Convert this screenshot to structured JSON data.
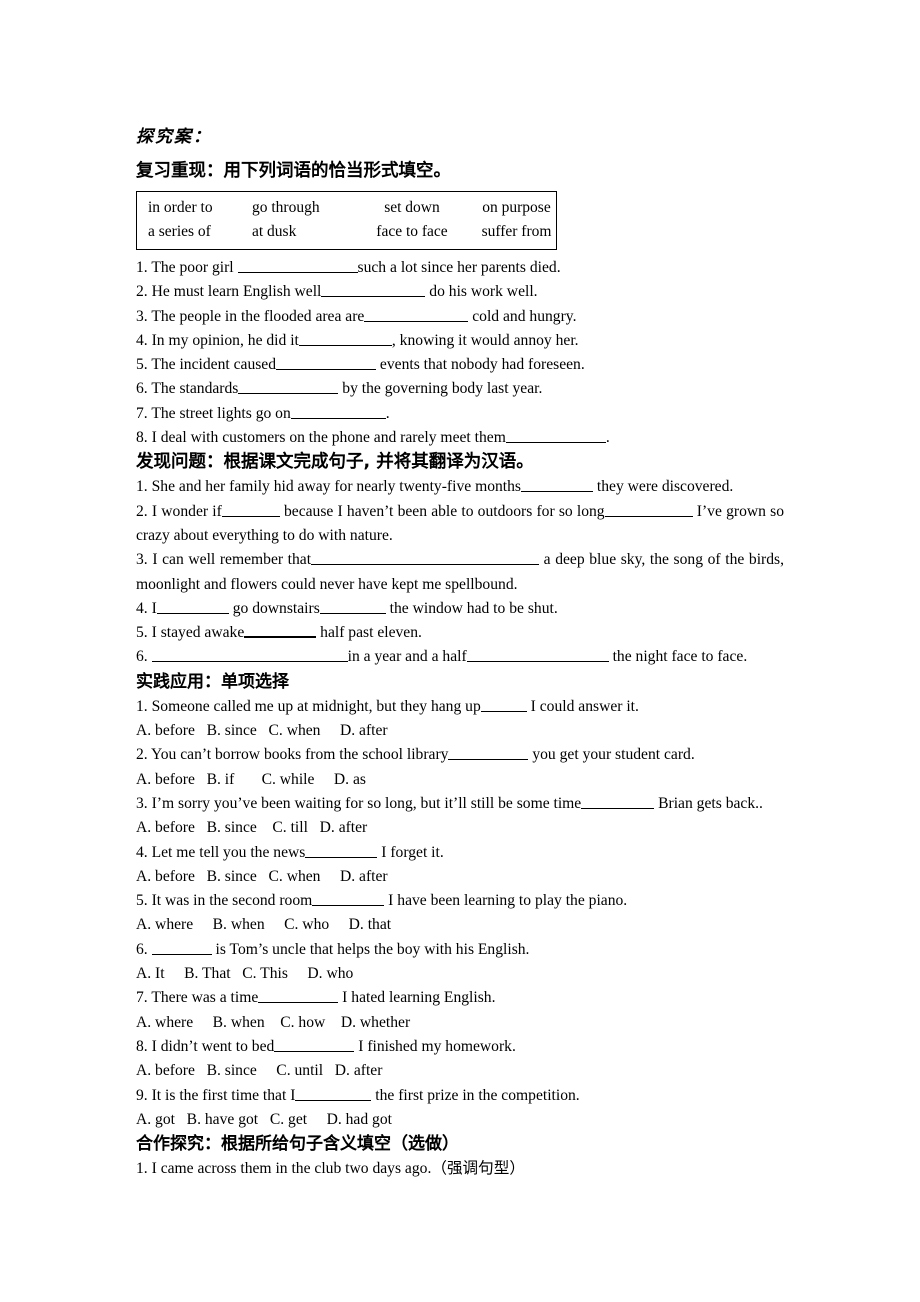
{
  "document": {
    "title": "探究案：",
    "sections": [
      {
        "id": "review",
        "heading": "复习重现：用下列词语的恰当形式填空。",
        "word_bank": {
          "rows": [
            [
              "in order to",
              "go through",
              "set down",
              "on purpose"
            ],
            [
              "a series of",
              "at dusk",
              "face to face",
              "suffer from"
            ]
          ]
        },
        "items": [
          {
            "num": "1.",
            "parts": [
              "The poor girl ",
              "such a lot since her parents died."
            ],
            "blank_widths": [
              120
            ]
          },
          {
            "num": "2.",
            "parts": [
              "He must learn English well",
              " do his work well."
            ],
            "blank_widths": [
              104
            ]
          },
          {
            "num": "3.",
            "parts": [
              "The people in the flooded area are",
              " cold and hungry."
            ],
            "blank_widths": [
              104
            ]
          },
          {
            "num": "4.",
            "parts": [
              "In my opinion, he did it",
              ", knowing it would annoy her."
            ],
            "blank_widths": [
              93
            ]
          },
          {
            "num": "5.",
            "parts": [
              "The incident caused",
              " events that nobody had foreseen."
            ],
            "blank_widths": [
              100
            ]
          },
          {
            "num": "6.",
            "parts": [
              "The standards",
              " by the governing body last year."
            ],
            "blank_widths": [
              100
            ]
          },
          {
            "num": "7.",
            "parts": [
              "The street lights go on",
              "."
            ],
            "blank_widths": [
              95
            ]
          },
          {
            "num": "8.",
            "parts": [
              "I deal with customers on the phone and rarely meet them",
              "."
            ],
            "blank_widths": [
              100
            ]
          }
        ]
      },
      {
        "id": "discover",
        "heading": "发现问题：根据课文完成句子, 并将其翻译为汉语。",
        "items": [
          {
            "num": "1.",
            "parts": [
              "She and her family hid away for nearly twenty-five months",
              " they were discovered."
            ],
            "blank_widths": [
              72
            ]
          },
          {
            "num": "2.",
            "parts": [
              "I wonder if",
              " because I haven’t been able to outdoors for so long",
              " I’ve grown so crazy about everything to do with nature."
            ],
            "blank_widths": [
              58,
              88
            ]
          },
          {
            "num": "3.",
            "parts": [
              "I can well remember that",
              " a deep blue sky, the song of the birds, moonlight and flowers could never have kept me spellbound."
            ],
            "blank_widths": [
              228
            ]
          },
          {
            "num": "4.",
            "parts": [
              "I",
              " go downstairs",
              " the window had to be shut."
            ],
            "blank_widths": [
              72,
              66
            ]
          },
          {
            "num": "5.",
            "parts": [
              "I stayed awake",
              " half past eleven."
            ],
            "blank_widths": [
              72
            ],
            "blank_style": "thick"
          },
          {
            "num": "6.",
            "parts": [
              "",
              "in a year and a half",
              " the night face to face."
            ],
            "blank_widths": [
              196,
              142
            ]
          }
        ]
      },
      {
        "id": "practice",
        "heading": "实践应用：单项选择",
        "items": [
          {
            "num": "1.",
            "parts": [
              "Someone called me up at midnight, but they hang up",
              " I could answer it."
            ],
            "blank_widths": [
              46
            ],
            "options": "A. before   B. since   C. when     D. after"
          },
          {
            "num": "2.",
            "parts": [
              "You can’t borrow books from the school library",
              " you get your student card."
            ],
            "blank_widths": [
              80
            ],
            "options": "A. before   B. if       C. while     D. as"
          },
          {
            "num": "3.",
            "parts": [
              "I’m sorry you’ve been waiting for so long, but it’ll still be some time",
              " Brian gets back.."
            ],
            "blank_widths": [
              73
            ],
            "options": "A. before   B. since    C. till   D. after"
          },
          {
            "num": "4.",
            "parts": [
              "Let me tell you the news",
              " I forget it."
            ],
            "blank_widths": [
              72
            ],
            "options": "A. before   B. since   C. when     D. after"
          },
          {
            "num": "5.",
            "parts": [
              "It was in the second room",
              " I have been learning to play the piano."
            ],
            "blank_widths": [
              72
            ],
            "options": "A. where     B. when     C. who     D. that"
          },
          {
            "num": "6.",
            "parts": [
              "",
              " is Tom’s uncle that helps the boy with his English."
            ],
            "blank_widths": [
              60
            ],
            "options": "A. It     B. That   C. This     D. who"
          },
          {
            "num": "7.",
            "parts": [
              "There was a time",
              " I hated learning English."
            ],
            "blank_widths": [
              80
            ],
            "options": "A. where     B. when    C. how    D. whether"
          },
          {
            "num": "8.",
            "parts": [
              "I didn’t went to bed",
              " I finished my homework."
            ],
            "blank_widths": [
              80
            ],
            "options": "A. before   B. since     C. until   D. after"
          },
          {
            "num": "9.",
            "parts": [
              "It is the first time that I",
              " the first prize in the competition."
            ],
            "blank_widths": [
              76
            ],
            "options": "A. got   B. have got   C. get     D. had got"
          }
        ]
      },
      {
        "id": "cooperate",
        "heading": "合作探究：根据所给句子含义填空（选做）",
        "items": [
          {
            "num": "1.",
            "parts": [
              "I came across them in the club two days ago.（强调句型）"
            ],
            "blank_widths": []
          }
        ]
      }
    ]
  },
  "colors": {
    "page_background": "#ffffff",
    "text": "#000000",
    "rule": "#000000"
  }
}
